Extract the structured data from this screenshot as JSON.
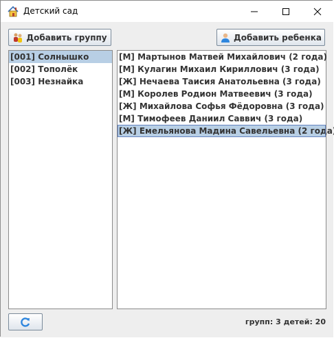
{
  "window": {
    "title": "Детский сад",
    "icon": "house-icon"
  },
  "toolbar": {
    "add_group_label": "Добавить группу",
    "add_child_label": "Добавить ребенка"
  },
  "groups": [
    {
      "label": "[001] Солнышко",
      "selected": true
    },
    {
      "label": "[002] Тополёк",
      "selected": false
    },
    {
      "label": "[003] Незнайка",
      "selected": false
    }
  ],
  "children": [
    {
      "label": "[М] Мартынов Матвей Михайлович (2 года)",
      "selected": false
    },
    {
      "label": "[М] Кулагин Михаил Кириллович (3 года)",
      "selected": false
    },
    {
      "label": "[Ж] Нечаева Таисия Анатольевна (3 года)",
      "selected": false
    },
    {
      "label": "[М] Королев Родион Матвеевич (3 года)",
      "selected": false
    },
    {
      "label": "[Ж] Михайлова Софья Фёдоровна (3 года)",
      "selected": false
    },
    {
      "label": "[М] Тимофеев Даниил Саввич (3 года)",
      "selected": false
    },
    {
      "label": "[Ж] Емельянова Мадина Савельевна (2 года)",
      "selected": true
    }
  ],
  "status": {
    "text": "групп: 3 детей: 20"
  },
  "colors": {
    "selection": "#b8cfe5",
    "selection_border": "#6382bf",
    "panel": "#eeeeee"
  }
}
